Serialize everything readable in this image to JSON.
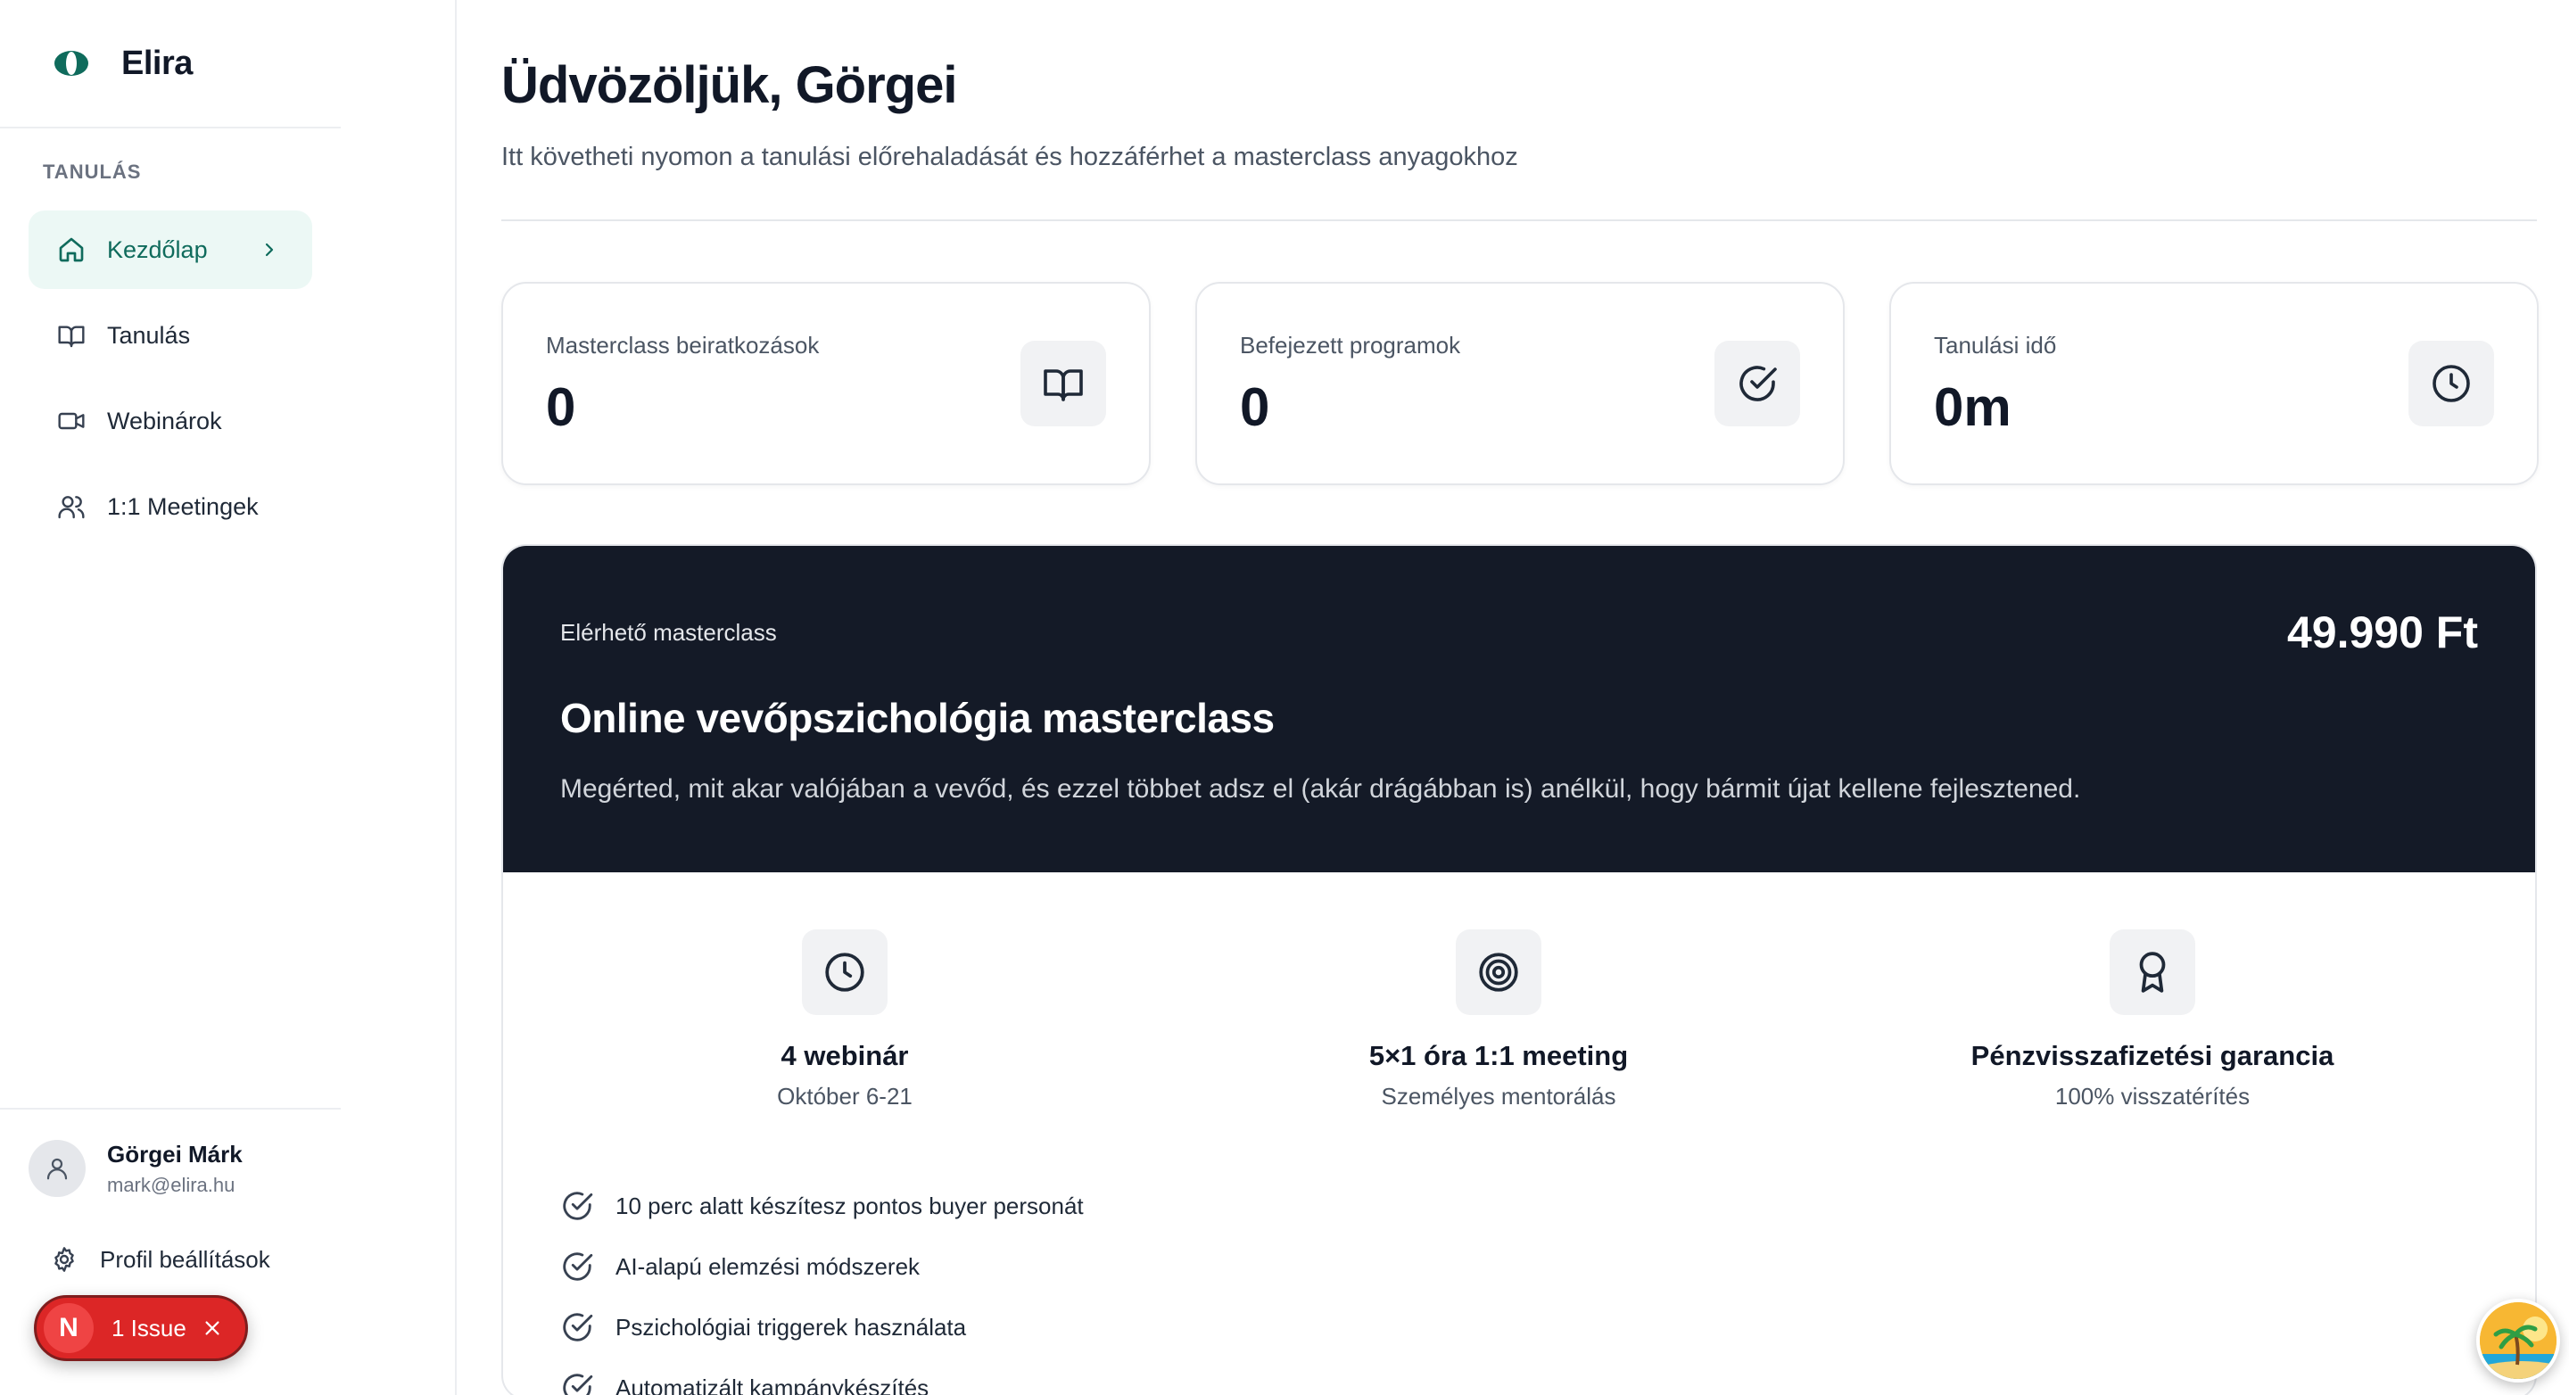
{
  "app": {
    "name": "Elira"
  },
  "sidebar": {
    "section_label": "TANULÁS",
    "items": [
      {
        "label": "Kezdőlap",
        "icon": "home-icon",
        "active": true
      },
      {
        "label": "Tanulás",
        "icon": "book-icon",
        "active": false
      },
      {
        "label": "Webinárok",
        "icon": "video-icon",
        "active": false
      },
      {
        "label": "1:1 Meetingek",
        "icon": "users-icon",
        "active": false
      }
    ],
    "user": {
      "name": "Görgei Márk",
      "email": "mark@elira.hu"
    },
    "profile_settings": "Profil beállítások",
    "issue_badge": {
      "letter": "N",
      "label": "1 Issue"
    }
  },
  "header": {
    "title": "Üdvözöljük, Görgei",
    "subtitle": "Itt követheti nyomon a tanulási előrehaladását és hozzáférhet a masterclass anyagokhoz"
  },
  "stats": [
    {
      "label": "Masterclass beiratkozások",
      "value": "0",
      "icon": "book-open-icon"
    },
    {
      "label": "Befejezett programok",
      "value": "0",
      "icon": "check-circle-icon"
    },
    {
      "label": "Tanulási idő",
      "value": "0m",
      "icon": "clock-icon"
    }
  ],
  "masterclass": {
    "kicker": "Elérhető masterclass",
    "price": "49.990 Ft",
    "title": "Online vevőpszichológia masterclass",
    "description": "Megérted, mit akar valójában a vevőd, és ezzel többet adsz el (akár drágábban is) anélkül, hogy bármit újat kellene fejlesztened.",
    "features": [
      {
        "title": "4 webinár",
        "subtitle": "Október 6-21",
        "icon": "clock-icon"
      },
      {
        "title": "5×1 óra 1:1 meeting",
        "subtitle": "Személyes mentorálás",
        "icon": "target-icon"
      },
      {
        "title": "Pénzvisszafizetési garancia",
        "subtitle": "100% visszatérítés",
        "icon": "award-icon"
      }
    ],
    "benefits": [
      "10 perc alatt készítesz pontos buyer personát",
      "AI-alapú elemzési módszerek",
      "Pszichológiai triggerek használata",
      "Automatizált kampánykészítés"
    ]
  },
  "colors": {
    "accent": "#0f6b5c",
    "active_bg": "#ecf8f5",
    "hero_bg": "#141a27",
    "issue_red": "#dc2626"
  }
}
